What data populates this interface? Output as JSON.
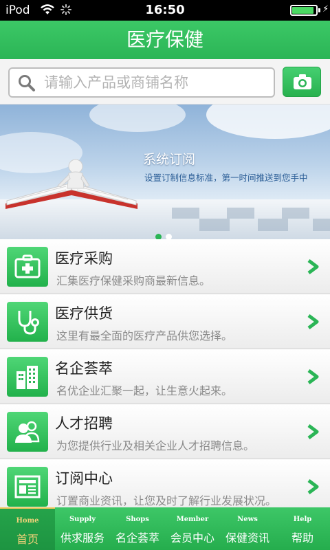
{
  "status": {
    "carrier": "iPod",
    "time": "16:50",
    "battery_level": 0.9
  },
  "header": {
    "title": "医疗保健"
  },
  "search": {
    "placeholder": "请输入产品或商铺名称",
    "search_icon": "search-icon",
    "camera_icon": "camera-icon"
  },
  "banner": {
    "title": "系统订阅",
    "subtitle": "设置订制信息标准，第一时间推送到您手中",
    "slide_count": 2,
    "active_slide": 1
  },
  "menu": {
    "items": [
      {
        "icon": "medical-kit-icon",
        "title": "医疗采购",
        "desc": "汇集医疗保健采购商最新信息。"
      },
      {
        "icon": "stethoscope-icon",
        "title": "医疗供货",
        "desc": "这里有最全面的医疗产品供您选择。"
      },
      {
        "icon": "buildings-icon",
        "title": "名企荟萃",
        "desc": "名优企业汇聚一起，让生意火起来。"
      },
      {
        "icon": "users-icon",
        "title": "人才招聘",
        "desc": "为您提供行业及相关企业人才招聘信息。"
      },
      {
        "icon": "newspaper-icon",
        "title": "订阅中心",
        "desc": "订置商业资讯，让您及时了解行业发展状况。"
      }
    ]
  },
  "tabs": [
    {
      "en": "Home",
      "zh": "首页",
      "active": true
    },
    {
      "en": "Supply",
      "zh": "供求服务",
      "active": false
    },
    {
      "en": "Shops",
      "zh": "名企荟萃",
      "active": false
    },
    {
      "en": "Member",
      "zh": "会员中心",
      "active": false
    },
    {
      "en": "News",
      "zh": "保健资讯",
      "active": false
    },
    {
      "en": "Help",
      "zh": "帮助",
      "active": false
    }
  ],
  "colors": {
    "brand_green": "#2bb556",
    "active_tab_accent": "#f3d27a"
  }
}
